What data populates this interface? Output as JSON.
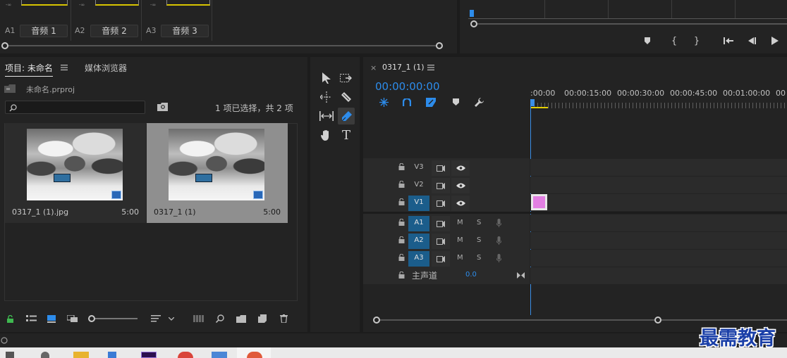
{
  "audio_mixer": {
    "channels": [
      {
        "id": "A1",
        "name": "音频 1"
      },
      {
        "id": "A2",
        "name": "音频 2"
      },
      {
        "id": "A3",
        "name": "音频 3"
      }
    ],
    "meter_marker": "-∞"
  },
  "project_panel": {
    "tabs": [
      {
        "label": "项目: 未命名",
        "active": true
      },
      {
        "label": "媒体浏览器",
        "active": false
      }
    ],
    "project_file": "未命名.prproj",
    "search_placeholder": "",
    "selection_status": "1 项已选择，共 2 项",
    "items": [
      {
        "name": "0317_1 (1).jpg",
        "duration": "5:00",
        "selected": false
      },
      {
        "name": "0317_1 (1)",
        "duration": "5:00",
        "selected": true
      }
    ]
  },
  "timeline": {
    "sequence_name": "0317_1 (1)",
    "close_glyph": "×",
    "timecode": "00:00:00:00",
    "ruler_labels": [
      ":00:00",
      "00:00:15:00",
      "00:00:30:00",
      "00:00:45:00",
      "00:01:00:00",
      "00"
    ],
    "video_tracks": [
      {
        "label": "V3",
        "active": false
      },
      {
        "label": "V2",
        "active": false
      },
      {
        "label": "V1",
        "active": true
      }
    ],
    "audio_tracks": [
      {
        "label": "A1",
        "m": "M",
        "s": "S"
      },
      {
        "label": "A2",
        "m": "M",
        "s": "S"
      },
      {
        "label": "A3",
        "m": "M",
        "s": "S"
      }
    ],
    "master": {
      "label": "主声道",
      "value": "0.0"
    },
    "clip_color": "#e27fe2"
  },
  "watermark": "最需教育",
  "colors": {
    "accent_blue": "#2d8ceb",
    "track_selected": "#1b5d8b",
    "playhead": "#3a8ee6"
  }
}
